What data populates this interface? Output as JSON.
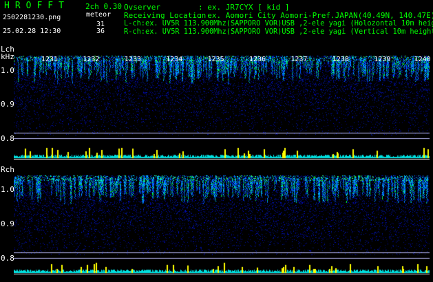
{
  "header": {
    "title": "HROFFT",
    "filename": "2502281230.png",
    "timestamp": "25.02.28 12:30",
    "mode": "2ch 0.30",
    "meteor_label": "meteor",
    "left_count": "31",
    "right_count": "36",
    "observer_label": "Ovserver",
    "observer_value": ": ex. JR7CYX [ kid ]",
    "location_label": "Receiving Location",
    "location_value": ": ex. Aomori City Aomori-Pref.JAPAN(40.49N, 140.47E)",
    "lch_info": "L-ch:ex. UV5R 113.900Mhz(SAPPORO VOR)USB ,2-ele yagi (Holozontal 10m height)",
    "rch_info": "R-ch:ex. UV5R 113.900Mhz(SAPPORO VOR)USB ,2-ele yagi (Vertical 10m height)"
  },
  "left_channel": {
    "label": "Lch",
    "unit": "kHz",
    "y_ticks": [
      "1.0",
      "0.9",
      "0.8"
    ]
  },
  "right_channel": {
    "label": "Rch",
    "y_ticks": [
      "1.0",
      "0.9",
      "0.8"
    ]
  },
  "time_markers": [
    "1231",
    "1232",
    "1233",
    "1234",
    "1235",
    "1236",
    "1237",
    "1238",
    "1239",
    "1240"
  ],
  "colors": {
    "background": "#000000",
    "text_green": "#00ff00",
    "text_white": "#ffffff",
    "noise_blue": "#0000a0",
    "signal_cyan": "#00ffff",
    "signal_green": "#00ff40",
    "spike_yellow": "#ffff00"
  }
}
